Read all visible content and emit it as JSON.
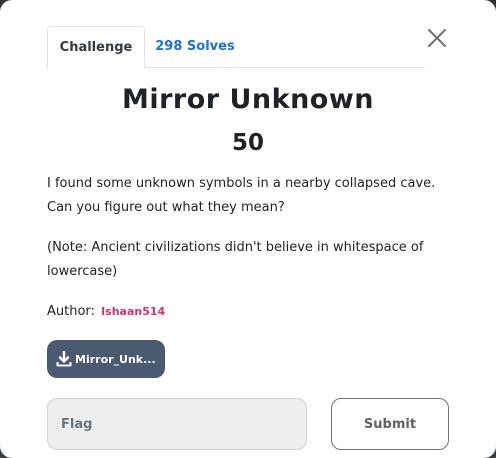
{
  "tabs": {
    "challenge_label": "Challenge",
    "solves_label": "298 Solves"
  },
  "challenge": {
    "name": "Mirror Unknown",
    "value": "50",
    "description_p1": "I found some unknown symbols in a nearby collapsed cave. Can you figure out what they mean?",
    "description_p2": "(Note: Ancient civilizations didn't believe in whitespace of lowercase)",
    "author_label": "Author:",
    "author_name": "Ishaan514"
  },
  "files": {
    "download_label": "Mirror_Unk..."
  },
  "form": {
    "flag_placeholder": "Flag",
    "flag_value": "",
    "submit_label": "Submit"
  },
  "icons": {
    "close": "close-icon",
    "download": "download-icon"
  },
  "colors": {
    "accent_link": "#1a73d9",
    "author_pink": "#d6336c",
    "download_button": "#4a5a72"
  }
}
